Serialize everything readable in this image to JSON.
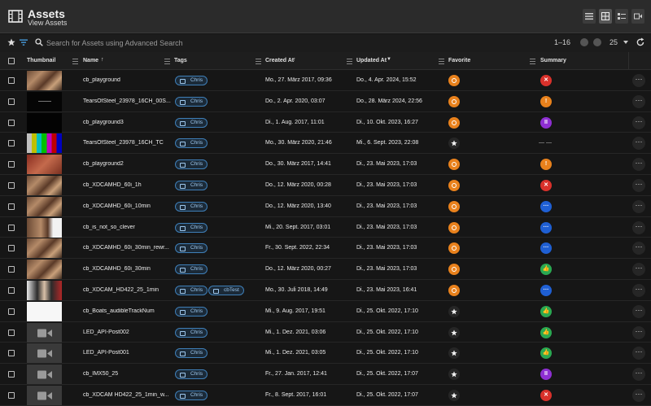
{
  "header": {
    "title": "Assets",
    "subtitle": "View Assets",
    "view_icons": [
      "list-view-icon",
      "grid-view-icon",
      "detail-view-icon",
      "video-icon"
    ]
  },
  "search": {
    "placeholder": "Search for Assets using Advanced Search",
    "range": "1–16",
    "page_size": "25"
  },
  "columns": {
    "thumbnail": "Thumbnail",
    "name": "Name",
    "tags": "Tags",
    "created": "Created At",
    "updated": "Updated At",
    "favorite": "Favorite",
    "summary": "Summary"
  },
  "colors": {
    "accent": "#e8811c",
    "tag_border": "#3f7fb8",
    "summary_red": "#d9312b",
    "summary_orange": "#e8811c",
    "summary_purple": "#8e2fd2",
    "summary_blue": "#1f5fd3",
    "summary_green": "#2aa851"
  },
  "rows": [
    {
      "name": "cb_playground",
      "tags": [
        "Chris"
      ],
      "created": "Mo., 27. März 2017, 09:36",
      "updated": "Do., 4. Apr. 2024, 15:52",
      "favorite": true,
      "summary": "error",
      "summary_glyph": "✕",
      "thumb": "warm"
    },
    {
      "name": "TearsOfSteel_23978_16CH_00S...",
      "tags": [
        "Chris"
      ],
      "created": "Do., 2. Apr. 2020, 03:07",
      "updated": "Do., 28. März 2024, 22:56",
      "favorite": true,
      "summary": "warning",
      "summary_glyph": "!",
      "thumb": "black-text"
    },
    {
      "name": "cb_playground3",
      "tags": [
        "Chris"
      ],
      "created": "Di., 1. Aug. 2017, 11:01",
      "updated": "Di., 10. Okt. 2023, 16:27",
      "favorite": true,
      "summary": "paused",
      "summary_glyph": "II",
      "thumb": "black"
    },
    {
      "name": "TearsOfSteel_23978_16CH_TC",
      "tags": [
        "Chris"
      ],
      "created": "Mo., 30. März 2020, 21:46",
      "updated": "Mi., 6. Sept. 2023, 22:08",
      "favorite": false,
      "summary": "none",
      "summary_glyph": "— —",
      "thumb": "colorbars"
    },
    {
      "name": "cb_playground2",
      "tags": [
        "Chris"
      ],
      "created": "Do., 30. März 2017, 14:41",
      "updated": "Di., 23. Mai 2023, 17:03",
      "favorite": true,
      "summary": "warning",
      "summary_glyph": "!",
      "thumb": "red"
    },
    {
      "name": "cb_XDCAMHD_60i_1h",
      "tags": [
        "Chris"
      ],
      "created": "Do., 12. März 2020, 00:28",
      "updated": "Di., 23. Mai 2023, 17:03",
      "favorite": true,
      "summary": "error",
      "summary_glyph": "✕",
      "thumb": "warm"
    },
    {
      "name": "cb_XDCAMHD_60i_10min",
      "tags": [
        "Chris"
      ],
      "created": "Do., 12. März 2020, 13:40",
      "updated": "Di., 23. Mai 2023, 17:03",
      "favorite": true,
      "summary": "pending",
      "summary_glyph": "···",
      "thumb": "warm"
    },
    {
      "name": "cb_is_not_so_clever",
      "tags": [
        "Chris"
      ],
      "created": "Mi., 20. Sept. 2017, 03:01",
      "updated": "Di., 23. Mai 2023, 17:03",
      "favorite": true,
      "summary": "pending",
      "summary_glyph": "···",
      "thumb": "warm-white"
    },
    {
      "name": "cb_XDCAMHD_60i_30min_rewr...",
      "tags": [
        "Chris"
      ],
      "created": "Fr., 30. Sept. 2022, 22:34",
      "updated": "Di., 23. Mai 2023, 17:03",
      "favorite": true,
      "summary": "pending",
      "summary_glyph": "···",
      "thumb": "warm"
    },
    {
      "name": "cb_XDCAMHD_60i_30min",
      "tags": [
        "Chris"
      ],
      "created": "Do., 12. März 2020, 00:27",
      "updated": "Di., 23. Mai 2023, 17:03",
      "favorite": true,
      "summary": "success",
      "summary_glyph": "👍",
      "thumb": "warm"
    },
    {
      "name": "cb_XDCAM_HD422_25_1min",
      "tags": [
        "Chris",
        "cbTest"
      ],
      "created": "Mo., 30. Juli 2018, 14:49",
      "updated": "Di., 23. Mai 2023, 16:41",
      "favorite": true,
      "summary": "pending",
      "summary_glyph": "···",
      "thumb": "person"
    },
    {
      "name": "cb_Boats_audibleTrackNum",
      "tags": [
        "Chris"
      ],
      "created": "Mi., 9. Aug. 2017, 19:51",
      "updated": "Di., 25. Okt. 2022, 17:10",
      "favorite": false,
      "summary": "success",
      "summary_glyph": "👍",
      "thumb": "white"
    },
    {
      "name": "LED_API-Post002",
      "tags": [
        "Chris"
      ],
      "created": "Mi., 1. Dez. 2021, 03:06",
      "updated": "Di., 25. Okt. 2022, 17:10",
      "favorite": false,
      "summary": "success",
      "summary_glyph": "👍",
      "thumb": "camera"
    },
    {
      "name": "LED_API-Post001",
      "tags": [
        "Chris"
      ],
      "created": "Mi., 1. Dez. 2021, 03:05",
      "updated": "Di., 25. Okt. 2022, 17:10",
      "favorite": false,
      "summary": "success",
      "summary_glyph": "👍",
      "thumb": "camera"
    },
    {
      "name": "cb_IMX50_25",
      "tags": [
        "Chris"
      ],
      "created": "Fr., 27. Jan. 2017, 12:41",
      "updated": "Di., 25. Okt. 2022, 17:07",
      "favorite": false,
      "summary": "paused",
      "summary_glyph": "II",
      "thumb": "camera"
    },
    {
      "name": "cb_XDCAM HD422_25_1min_w...",
      "tags": [
        "Chris"
      ],
      "created": "Fr., 8. Sept. 2017, 16:01",
      "updated": "Di., 25. Okt. 2022, 17:07",
      "favorite": false,
      "summary": "error",
      "summary_glyph": "✕",
      "thumb": "camera"
    }
  ]
}
